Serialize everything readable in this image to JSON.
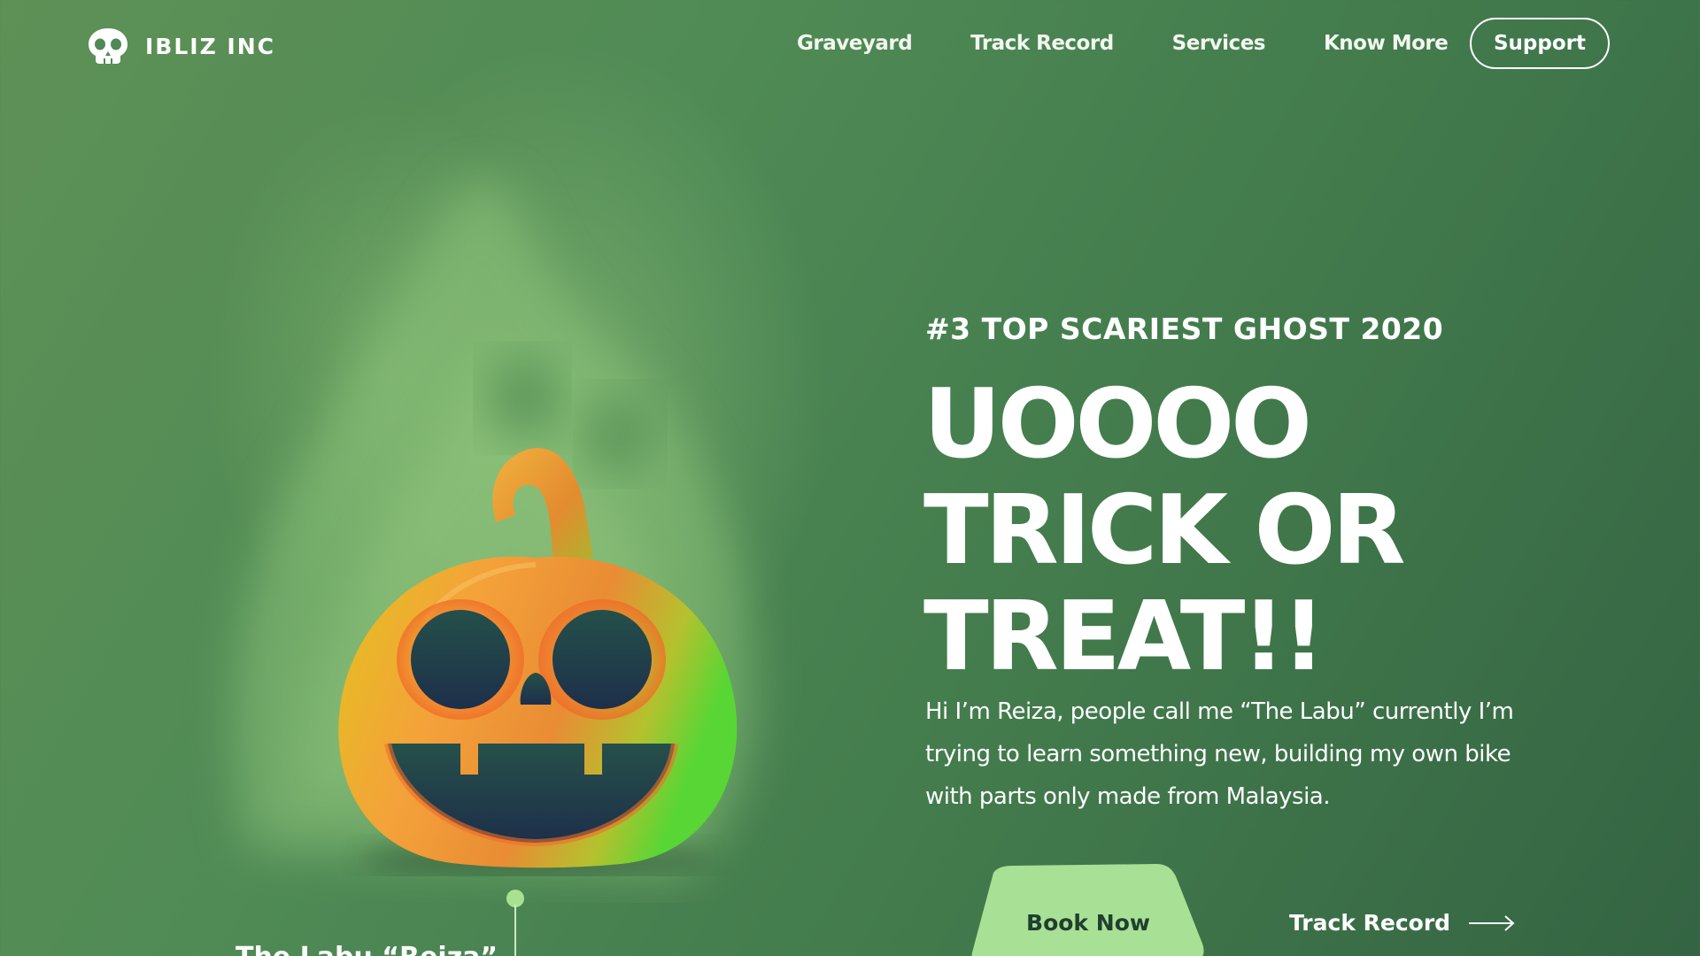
{
  "brand": {
    "name": "IBLIZ INC",
    "logo_icon": "skull-icon"
  },
  "nav": {
    "items": [
      "Graveyard",
      "Track Record",
      "Services",
      "Know More"
    ],
    "support_label": "Support"
  },
  "hero": {
    "eyebrow": "#3 TOP SCARIEST GHOST 2020",
    "title_lines": [
      "UOOOO",
      "TRICK OR",
      "TREAT!!"
    ],
    "body": "Hi I’m Reiza, people call me “The Labu” currently I’m trying to learn something new, building my own bike with parts only made from Malaysia.",
    "book_now_label": "Book Now",
    "track_record_label": "Track Record",
    "track_record_icon": "arrow-right-icon"
  },
  "pumpkin": {
    "caption": "The Labu “Reiza”",
    "icon": "jack-o-lantern-icon"
  },
  "colors": {
    "background_start": "#5e9156",
    "background_end": "#346443",
    "book_now_bg": "#a8e095",
    "text": "#ffffff"
  }
}
